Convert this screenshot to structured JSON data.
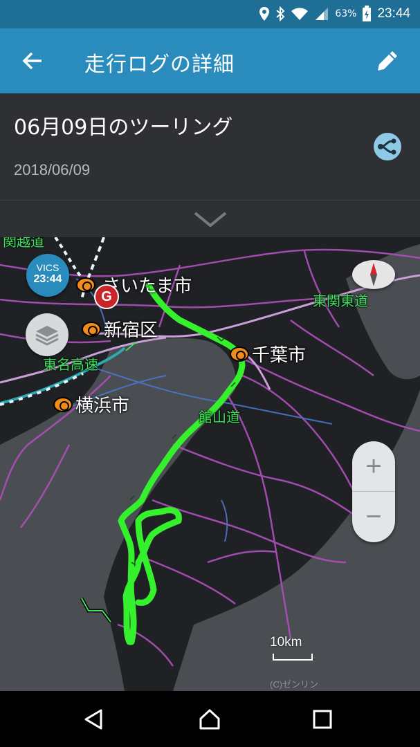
{
  "status_bar": {
    "battery": "63%",
    "clock": "23:44",
    "icons": [
      "location-icon",
      "bluetooth-icon",
      "wifi-icon",
      "signal-icon",
      "battery-charging-icon"
    ]
  },
  "app_bar": {
    "title": "走行ログの詳細",
    "back_icon": "back-arrow-icon",
    "edit_icon": "pencil-icon"
  },
  "trip": {
    "title": "06月09日のツーリング",
    "date": "2018/06/09",
    "share_icon": "share-route-icon"
  },
  "map": {
    "vics": {
      "label": "VICS",
      "time": "23:44"
    },
    "goal_marker": "G",
    "cities": {
      "saitama": "さいたま市",
      "shinjuku": "新宿区",
      "chiba": "千葉市",
      "yokohama": "横浜市"
    },
    "roads": {
      "kan_etsu": "関越道",
      "higashi_kanto": "東関東道",
      "tomei": "東名高速",
      "tateyama": "館山道"
    },
    "zoom_in": "+",
    "zoom_out": "−",
    "scale": "10km",
    "copyright": "(C)ゼンリン",
    "colors": {
      "route": "#35f02c",
      "land": "#1f2124",
      "sea": "#4a4d52",
      "roads": "#a94fb5",
      "highway": "#c9a0d6"
    }
  },
  "nav_bar": {
    "back": "nav-back-icon",
    "home": "nav-home-icon",
    "recents": "nav-recents-icon"
  }
}
